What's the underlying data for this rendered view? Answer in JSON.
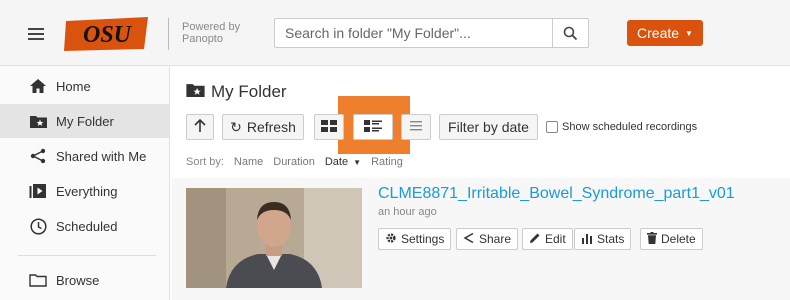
{
  "header": {
    "logo_text": "OSU",
    "powered_by": "Powered by",
    "powered_brand": "Panopto",
    "search_placeholder": "Search in folder \"My Folder\"...",
    "create_label": "Create"
  },
  "sidebar": {
    "items": [
      {
        "label": "Home",
        "icon": "home-icon"
      },
      {
        "label": "My Folder",
        "icon": "folder-star-icon",
        "active": true
      },
      {
        "label": "Shared with Me",
        "icon": "share-icon"
      },
      {
        "label": "Everything",
        "icon": "play-stack-icon"
      },
      {
        "label": "Scheduled",
        "icon": "clock-icon"
      },
      {
        "label": "Browse",
        "icon": "folder-icon"
      }
    ]
  },
  "main": {
    "folder_title": "My Folder",
    "toolbar": {
      "refresh_label": "Refresh",
      "filter_label": "Filter by date",
      "show_scheduled_label": "Show scheduled recordings"
    },
    "sort": {
      "label": "Sort by:",
      "options": [
        "Name",
        "Duration",
        "Date",
        "Rating"
      ],
      "active": "Date"
    },
    "session": {
      "title": "CLME8871_Irritable_Bowel_Syndrome_part1_v01",
      "time": "an hour ago",
      "actions": [
        "Settings",
        "Share",
        "Edit",
        "Stats",
        "Delete"
      ]
    }
  },
  "colors": {
    "brand_orange": "#d9530f",
    "highlight_orange": "#ee7f2d",
    "link_blue": "#1b9bd7"
  }
}
